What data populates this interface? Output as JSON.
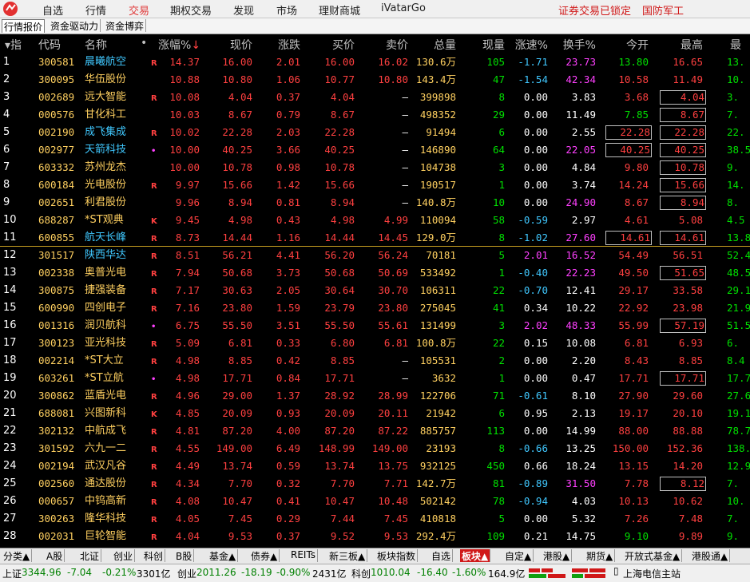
{
  "menu": {
    "items": [
      "自选",
      "行情",
      "交易",
      "期权交易",
      "发现",
      "市场",
      "理财商城",
      "iVatarGo"
    ],
    "right_lock": "证券交易已锁定",
    "right_theme": "国防军工"
  },
  "subtabs": [
    "行情报价",
    "资金驱动力",
    "资金博弈"
  ],
  "columns": {
    "idx": "指",
    "code": "代码",
    "name": "名称",
    "dot": "•",
    "pct": "涨幅%",
    "price": "现价",
    "chg": "涨跌",
    "bid": "买价",
    "ask": "卖价",
    "vol": "总量",
    "cur": "现量",
    "speed": "涨速%",
    "turn": "换手%",
    "open": "今开",
    "high": "最高",
    "low": "最"
  },
  "rows": [
    {
      "n": "1",
      "code": "300581",
      "name": "晨曦航空",
      "tag": "R",
      "pct": "14.37",
      "price": "16.00",
      "chg": "2.01",
      "bid": "16.00",
      "ask": "16.02",
      "vol": "130.6万",
      "cur": "105",
      "speed": "-1.71",
      "turn": "23.73",
      "open": "13.80",
      "high": "16.65",
      "low": "13."
    },
    {
      "n": "2",
      "code": "300095",
      "name": "华伍股份",
      "tag": "",
      "pct": "10.88",
      "price": "10.80",
      "chg": "1.06",
      "bid": "10.77",
      "ask": "10.80",
      "vol": "143.4万",
      "cur": "47",
      "speed": "-1.54",
      "turn": "42.34",
      "open": "10.58",
      "high": "11.49",
      "low": "10."
    },
    {
      "n": "3",
      "code": "002689",
      "name": "远大智能",
      "tag": "R",
      "pct": "10.08",
      "price": "4.04",
      "chg": "0.37",
      "bid": "4.04",
      "ask": "—",
      "vol": "399898",
      "cur": "8",
      "speed": "0.00",
      "turn": "3.83",
      "open": "3.68",
      "high": "4.04",
      "low": "3."
    },
    {
      "n": "4",
      "code": "000576",
      "name": "甘化科工",
      "tag": "",
      "pct": "10.03",
      "price": "8.67",
      "chg": "0.79",
      "bid": "8.67",
      "ask": "—",
      "vol": "498352",
      "cur": "29",
      "speed": "0.00",
      "turn": "11.49",
      "open": "7.85",
      "high": "8.67",
      "low": "7."
    },
    {
      "n": "5",
      "code": "002190",
      "name": "成飞集成",
      "tag": "R",
      "pct": "10.02",
      "price": "22.28",
      "chg": "2.03",
      "bid": "22.28",
      "ask": "—",
      "vol": "91494",
      "cur": "6",
      "speed": "0.00",
      "turn": "2.55",
      "open": "22.28",
      "high": "22.28",
      "low": "22."
    },
    {
      "n": "6",
      "code": "002977",
      "name": "天箭科技",
      "tag": "•",
      "pct": "10.00",
      "price": "40.25",
      "chg": "3.66",
      "bid": "40.25",
      "ask": "—",
      "vol": "146890",
      "cur": "64",
      "speed": "0.00",
      "turn": "22.05",
      "open": "40.25",
      "high": "40.25",
      "low": "38.5"
    },
    {
      "n": "7",
      "code": "603332",
      "name": "苏州龙杰",
      "tag": "",
      "pct": "10.00",
      "price": "10.78",
      "chg": "0.98",
      "bid": "10.78",
      "ask": "—",
      "vol": "104738",
      "cur": "3",
      "speed": "0.00",
      "turn": "4.84",
      "open": "9.80",
      "high": "10.78",
      "low": "9."
    },
    {
      "n": "8",
      "code": "600184",
      "name": "光电股份",
      "tag": "R",
      "pct": "9.97",
      "price": "15.66",
      "chg": "1.42",
      "bid": "15.66",
      "ask": "—",
      "vol": "190517",
      "cur": "1",
      "speed": "0.00",
      "turn": "3.74",
      "open": "14.24",
      "high": "15.66",
      "low": "14."
    },
    {
      "n": "9",
      "code": "002651",
      "name": "利君股份",
      "tag": "",
      "pct": "9.96",
      "price": "8.94",
      "chg": "0.81",
      "bid": "8.94",
      "ask": "—",
      "vol": "140.8万",
      "cur": "10",
      "speed": "0.00",
      "turn": "24.90",
      "open": "8.67",
      "high": "8.94",
      "low": "8."
    },
    {
      "n": "10",
      "code": "688287",
      "name": "*ST观典",
      "tag": "K",
      "pct": "9.45",
      "price": "4.98",
      "chg": "0.43",
      "bid": "4.98",
      "ask": "4.99",
      "vol": "110094",
      "cur": "58",
      "speed": "-0.59",
      "turn": "2.97",
      "open": "4.61",
      "high": "5.08",
      "low": "4.5"
    },
    {
      "n": "11",
      "code": "600855",
      "name": "航天长峰",
      "tag": "R",
      "pct": "8.73",
      "price": "14.44",
      "chg": "1.16",
      "bid": "14.44",
      "ask": "14.45",
      "vol": "129.0万",
      "cur": "8",
      "speed": "-1.02",
      "turn": "27.60",
      "open": "14.61",
      "high": "14.61",
      "low": "13.8"
    },
    {
      "n": "12",
      "code": "301517",
      "name": "陕西华达",
      "tag": "R",
      "pct": "8.51",
      "price": "56.21",
      "chg": "4.41",
      "bid": "56.20",
      "ask": "56.24",
      "vol": "70181",
      "cur": "5",
      "speed": "2.01",
      "turn": "16.52",
      "open": "54.49",
      "high": "56.51",
      "low": "52.4"
    },
    {
      "n": "13",
      "code": "002338",
      "name": "奥普光电",
      "tag": "R",
      "pct": "7.94",
      "price": "50.68",
      "chg": "3.73",
      "bid": "50.68",
      "ask": "50.69",
      "vol": "533492",
      "cur": "1",
      "speed": "-0.40",
      "turn": "22.23",
      "open": "49.50",
      "high": "51.65",
      "low": "48.5"
    },
    {
      "n": "14",
      "code": "300875",
      "name": "捷强装备",
      "tag": "R",
      "pct": "7.17",
      "price": "30.63",
      "chg": "2.05",
      "bid": "30.64",
      "ask": "30.70",
      "vol": "106311",
      "cur": "22",
      "speed": "-0.70",
      "turn": "12.41",
      "open": "29.17",
      "high": "33.58",
      "low": "29.1"
    },
    {
      "n": "15",
      "code": "600990",
      "name": "四创电子",
      "tag": "R",
      "pct": "7.16",
      "price": "23.80",
      "chg": "1.59",
      "bid": "23.79",
      "ask": "23.80",
      "vol": "275045",
      "cur": "41",
      "speed": "0.34",
      "turn": "10.22",
      "open": "22.92",
      "high": "23.98",
      "low": "21.9"
    },
    {
      "n": "16",
      "code": "001316",
      "name": "润贝航科",
      "tag": "•",
      "pct": "6.75",
      "price": "55.50",
      "chg": "3.51",
      "bid": "55.50",
      "ask": "55.61",
      "vol": "131499",
      "cur": "3",
      "speed": "2.02",
      "turn": "48.33",
      "open": "55.99",
      "high": "57.19",
      "low": "51.5"
    },
    {
      "n": "17",
      "code": "300123",
      "name": "亚光科技",
      "tag": "R",
      "pct": "5.09",
      "price": "6.81",
      "chg": "0.33",
      "bid": "6.80",
      "ask": "6.81",
      "vol": "100.8万",
      "cur": "22",
      "speed": "0.15",
      "turn": "10.08",
      "open": "6.81",
      "high": "6.93",
      "low": "6."
    },
    {
      "n": "18",
      "code": "002214",
      "name": "*ST大立",
      "tag": "R",
      "pct": "4.98",
      "price": "8.85",
      "chg": "0.42",
      "bid": "8.85",
      "ask": "—",
      "vol": "105531",
      "cur": "2",
      "speed": "0.00",
      "turn": "2.20",
      "open": "8.43",
      "high": "8.85",
      "low": "8.4"
    },
    {
      "n": "19",
      "code": "603261",
      "name": "*ST立航",
      "tag": "•",
      "pct": "4.98",
      "price": "17.71",
      "chg": "0.84",
      "bid": "17.71",
      "ask": "—",
      "vol": "3632",
      "cur": "1",
      "speed": "0.00",
      "turn": "0.47",
      "open": "17.71",
      "high": "17.71",
      "low": "17.7"
    },
    {
      "n": "20",
      "code": "300862",
      "name": "蓝盾光电",
      "tag": "R",
      "pct": "4.96",
      "price": "29.00",
      "chg": "1.37",
      "bid": "28.92",
      "ask": "28.99",
      "vol": "122706",
      "cur": "71",
      "speed": "-0.61",
      "turn": "8.10",
      "open": "27.90",
      "high": "29.60",
      "low": "27.6"
    },
    {
      "n": "21",
      "code": "688081",
      "name": "兴图新科",
      "tag": "K",
      "pct": "4.85",
      "price": "20.09",
      "chg": "0.93",
      "bid": "20.09",
      "ask": "20.11",
      "vol": "21942",
      "cur": "6",
      "speed": "0.95",
      "turn": "2.13",
      "open": "19.17",
      "high": "20.10",
      "low": "19.1"
    },
    {
      "n": "22",
      "code": "302132",
      "name": "中航成飞",
      "tag": "R",
      "pct": "4.81",
      "price": "87.20",
      "chg": "4.00",
      "bid": "87.20",
      "ask": "87.22",
      "vol": "885757",
      "cur": "113",
      "speed": "0.00",
      "turn": "14.99",
      "open": "88.00",
      "high": "88.88",
      "low": "78.7"
    },
    {
      "n": "23",
      "code": "301592",
      "name": "六九一二",
      "tag": "R",
      "pct": "4.55",
      "price": "149.00",
      "chg": "6.49",
      "bid": "148.99",
      "ask": "149.00",
      "vol": "23193",
      "cur": "8",
      "speed": "-0.66",
      "turn": "13.25",
      "open": "150.00",
      "high": "152.36",
      "low": "138.5"
    },
    {
      "n": "24",
      "code": "002194",
      "name": "武汉凡谷",
      "tag": "R",
      "pct": "4.49",
      "price": "13.74",
      "chg": "0.59",
      "bid": "13.74",
      "ask": "13.75",
      "vol": "932125",
      "cur": "450",
      "speed": "0.66",
      "turn": "18.24",
      "open": "13.15",
      "high": "14.20",
      "low": "12.9"
    },
    {
      "n": "25",
      "code": "002560",
      "name": "通达股份",
      "tag": "R",
      "pct": "4.34",
      "price": "7.70",
      "chg": "0.32",
      "bid": "7.70",
      "ask": "7.71",
      "vol": "142.7万",
      "cur": "81",
      "speed": "-0.89",
      "turn": "31.50",
      "open": "7.78",
      "high": "8.12",
      "low": "7."
    },
    {
      "n": "26",
      "code": "000657",
      "name": "中钨高新",
      "tag": "R",
      "pct": "4.08",
      "price": "10.47",
      "chg": "0.41",
      "bid": "10.47",
      "ask": "10.48",
      "vol": "502142",
      "cur": "78",
      "speed": "-0.94",
      "turn": "4.03",
      "open": "10.13",
      "high": "10.62",
      "low": "10."
    },
    {
      "n": "27",
      "code": "300263",
      "name": "隆华科技",
      "tag": "R",
      "pct": "4.05",
      "price": "7.45",
      "chg": "0.29",
      "bid": "7.44",
      "ask": "7.45",
      "vol": "410818",
      "cur": "5",
      "speed": "0.00",
      "turn": "5.32",
      "open": "7.26",
      "high": "7.48",
      "low": "7."
    },
    {
      "n": "28",
      "code": "002031",
      "name": "巨轮智能",
      "tag": "R",
      "pct": "4.04",
      "price": "9.53",
      "chg": "0.37",
      "bid": "9.52",
      "ask": "9.53",
      "vol": "292.4万",
      "cur": "109",
      "speed": "0.21",
      "turn": "14.75",
      "open": "9.10",
      "high": "9.89",
      "low": "9."
    }
  ],
  "row_styles": {
    "name_cyan": [
      "1",
      "5",
      "6",
      "11",
      "12"
    ],
    "open_boxed": [
      "5",
      "6",
      "11"
    ],
    "high_boxed": [
      "3",
      "4",
      "5",
      "6",
      "7",
      "8",
      "9",
      "11",
      "13",
      "16",
      "19",
      "25"
    ],
    "turn_magenta": [
      "1",
      "2",
      "6",
      "9",
      "11",
      "12",
      "13",
      "16",
      "25"
    ],
    "speed_magenta": [
      "12",
      "16"
    ]
  },
  "bottom_tabs": [
    "分类▲",
    "A股",
    "北证",
    "创业",
    "科创",
    "B股",
    "基金▲",
    "债券▲",
    "REITs",
    "新三板▲",
    "板块指数",
    "自选",
    "板块▲",
    "自定▲",
    "港股▲",
    "期货▲",
    "开放式基金▲",
    "港股通▲"
  ],
  "bottom_active": "板块▲",
  "status": {
    "sh_label": "上证",
    "sh_value": "3344.96",
    "sh_chg": "-7.04",
    "sh_pct": "-0.21%",
    "sh_amt": "3301亿",
    "cy_label": "创业",
    "cy_value": "2011.26",
    "cy_chg": "-18.19",
    "cy_pct": "-0.90%",
    "cy_amt": "2431亿",
    "kc_label": "科创",
    "kc_value": "1010.04",
    "kc_chg": "-16.40",
    "kc_pct": "-1.60%",
    "kc_amt": "164.9亿",
    "broker": "上海电信主站"
  },
  "colors": {
    "up": "#ff4040",
    "down": "#00e000",
    "cyan": "#40c8ff",
    "yellow": "#ffff40",
    "magenta": "#ff40ff",
    "gold": "#ffd060"
  }
}
